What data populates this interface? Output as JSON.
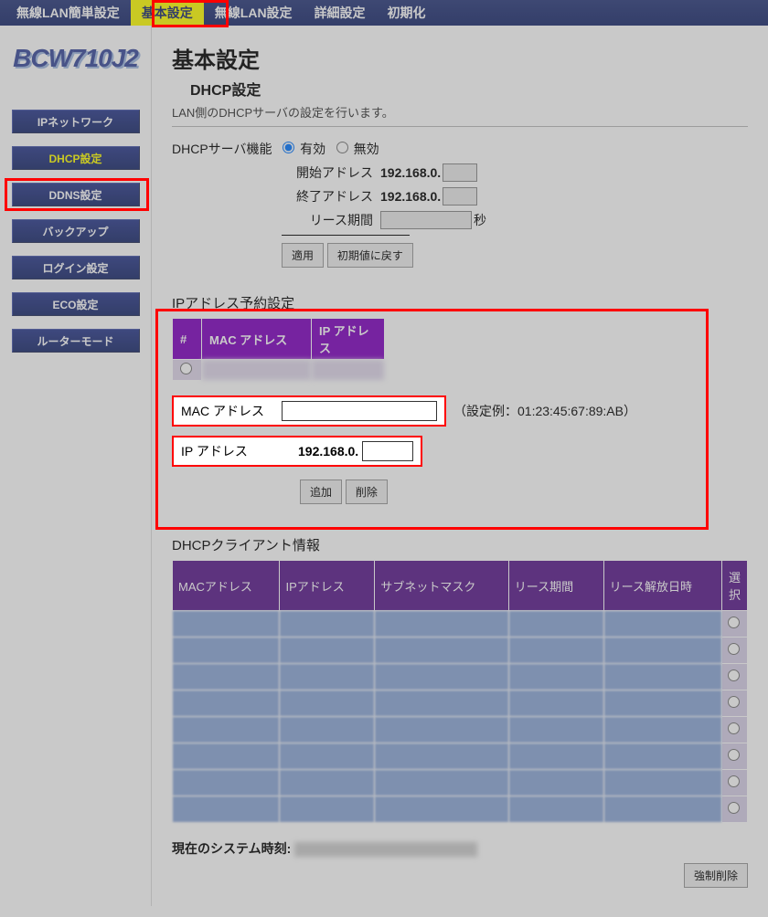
{
  "topnav": {
    "items": [
      "無線LAN簡単設定",
      "基本設定",
      "無線LAN設定",
      "詳細設定",
      "初期化"
    ],
    "active_index": 1
  },
  "logo": "BCW710J2",
  "sidebar": {
    "items": [
      "IPネットワーク",
      "DHCP設定",
      "DDNS設定",
      "バックアップ",
      "ログイン設定",
      "ECO設定",
      "ルーターモード"
    ],
    "active_index": 1
  },
  "page": {
    "title": "基本設定",
    "subtitle": "DHCP設定",
    "desc": "LAN側のDHCPサーバの設定を行います。"
  },
  "dhcp": {
    "func_label": "DHCPサーバ機能",
    "enable": "有効",
    "disable": "無効",
    "start_label": "開始アドレス",
    "start_prefix": "192.168.0.",
    "start_suffix": "",
    "end_label": "終了アドレス",
    "end_prefix": "192.168.0.",
    "end_suffix": "",
    "lease_label": "リース期間",
    "lease_value": "",
    "lease_unit": "秒",
    "apply": "適用",
    "reset": "初期値に戻す"
  },
  "reservation": {
    "title": "IPアドレス予約設定",
    "col_num": "#",
    "col_mac": "MAC アドレス",
    "col_ip": "IP アドレス",
    "row0_mac": "",
    "row0_ip": "",
    "mac_label": "MAC アドレス",
    "mac_value": "",
    "example": "（設定例：01:23:45:67:89:AB）",
    "ip_label": "IP アドレス",
    "ip_prefix": "192.168.0.",
    "ip_value": "",
    "add": "追加",
    "delete": "削除"
  },
  "clients": {
    "title": "DHCPクライアント情報",
    "cols": [
      "MACアドレス",
      "IPアドレス",
      "サブネットマスク",
      "リース期間",
      "リース解放日時",
      "選択"
    ],
    "row_count": 8
  },
  "systime": {
    "label": "現在のシステム時刻:",
    "force_del": "強制削除"
  }
}
